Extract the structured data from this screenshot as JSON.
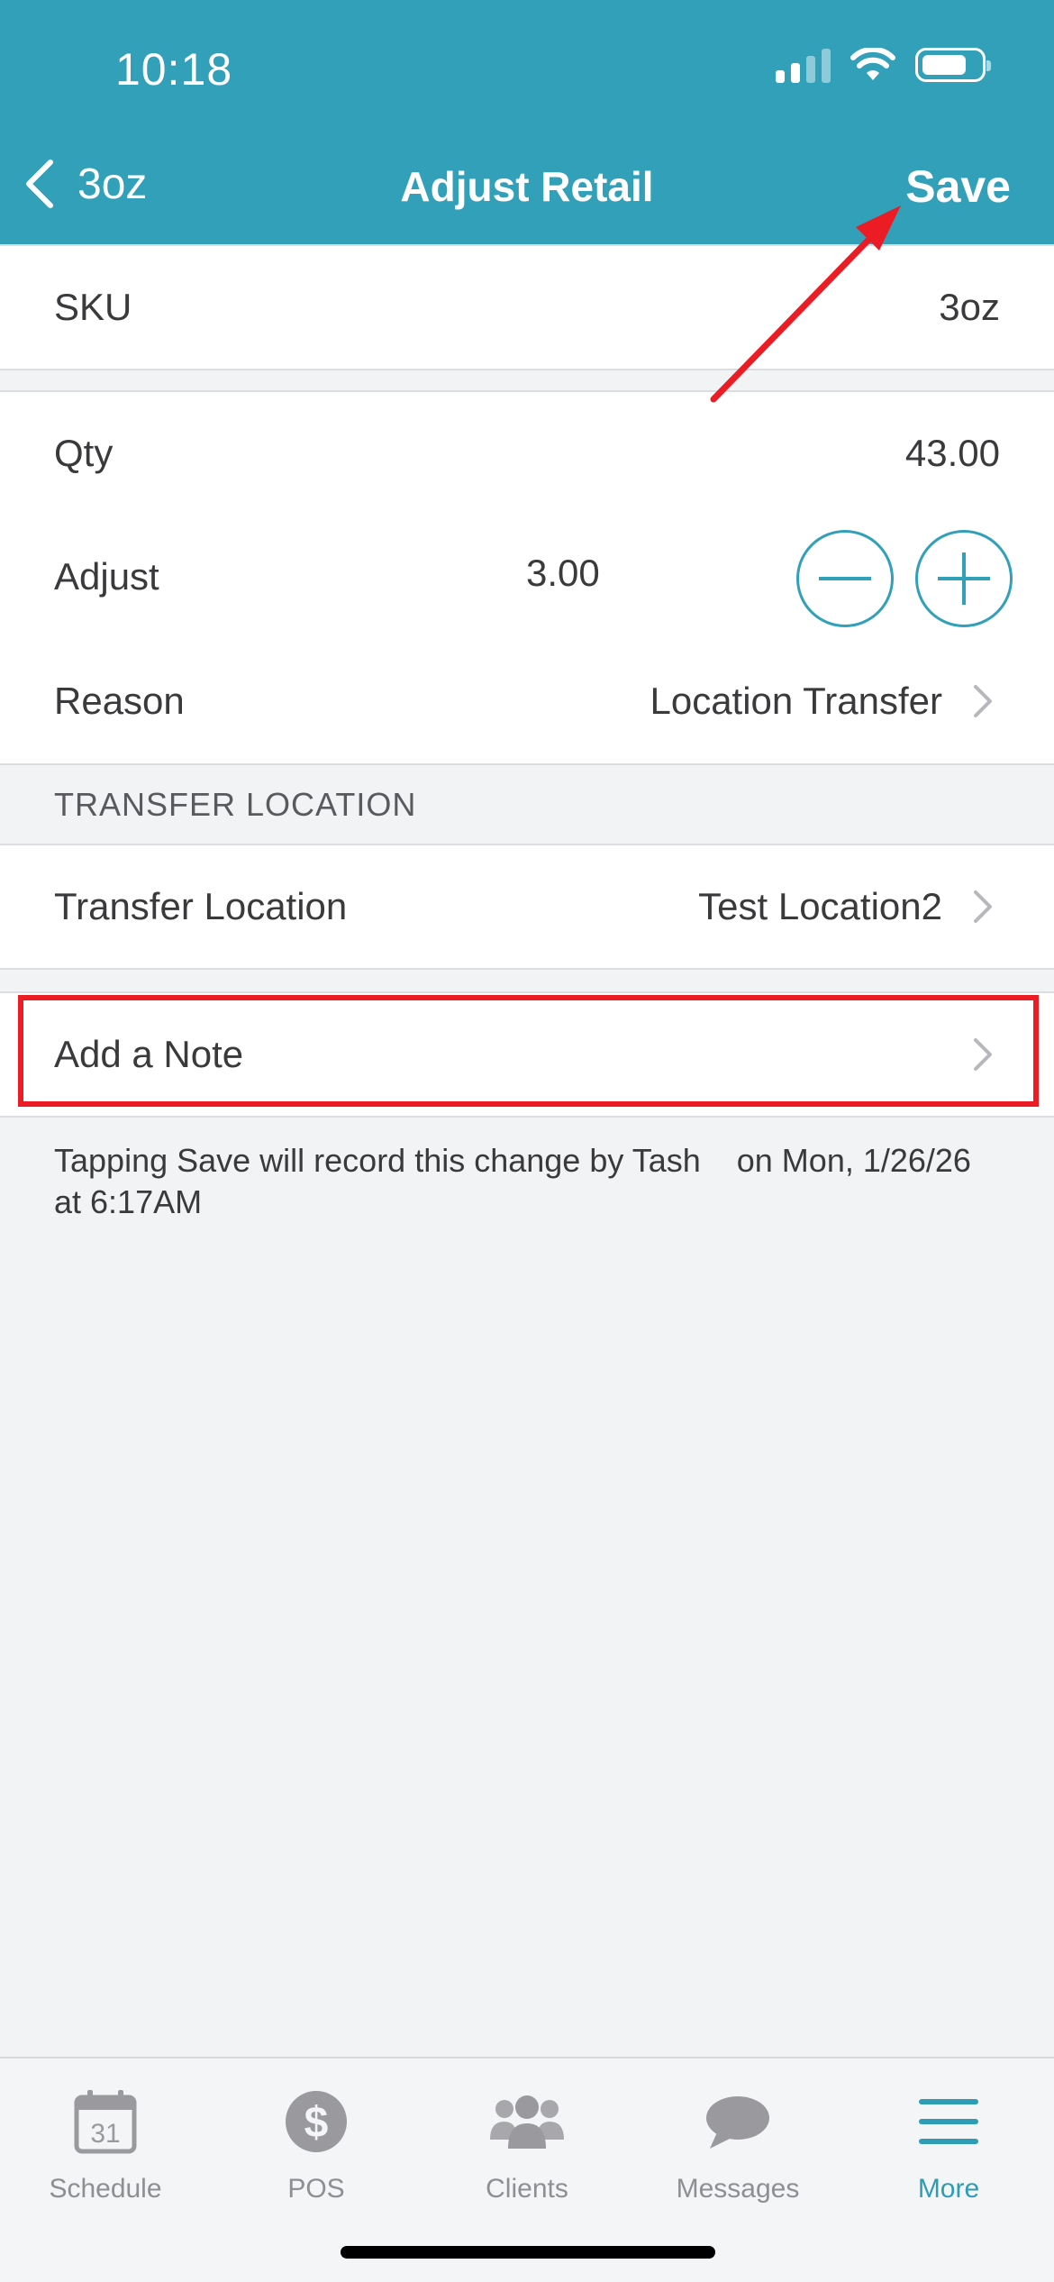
{
  "status_bar": {
    "time": "10:18"
  },
  "nav": {
    "back_label": "3oz",
    "title": "Adjust Retail",
    "save_label": "Save"
  },
  "rows": {
    "sku": {
      "label": "SKU",
      "value": "3oz"
    },
    "qty": {
      "label": "Qty",
      "value": "43.00"
    },
    "adjust": {
      "label": "Adjust",
      "value": "3.00"
    },
    "reason": {
      "label": "Reason",
      "value": "Location Transfer"
    },
    "transfer_location": {
      "label": "Transfer Location",
      "value": "Test Location2"
    },
    "note": {
      "label": "Add a Note"
    }
  },
  "section": {
    "transfer_header": "TRANSFER LOCATION"
  },
  "footnote": "Tapping Save will record this change by Tash    on Mon, 1/26/26\nat 6:17AM",
  "tabs": [
    {
      "label": "Schedule",
      "icon": "calendar-icon",
      "day": "31"
    },
    {
      "label": "POS",
      "icon": "dollar-icon"
    },
    {
      "label": "Clients",
      "icon": "clients-icon"
    },
    {
      "label": "Messages",
      "icon": "messages-icon"
    },
    {
      "label": "More",
      "icon": "menu-icon"
    }
  ],
  "colors": {
    "accent": "#32a0b8",
    "annotation": "#ec1c24"
  }
}
